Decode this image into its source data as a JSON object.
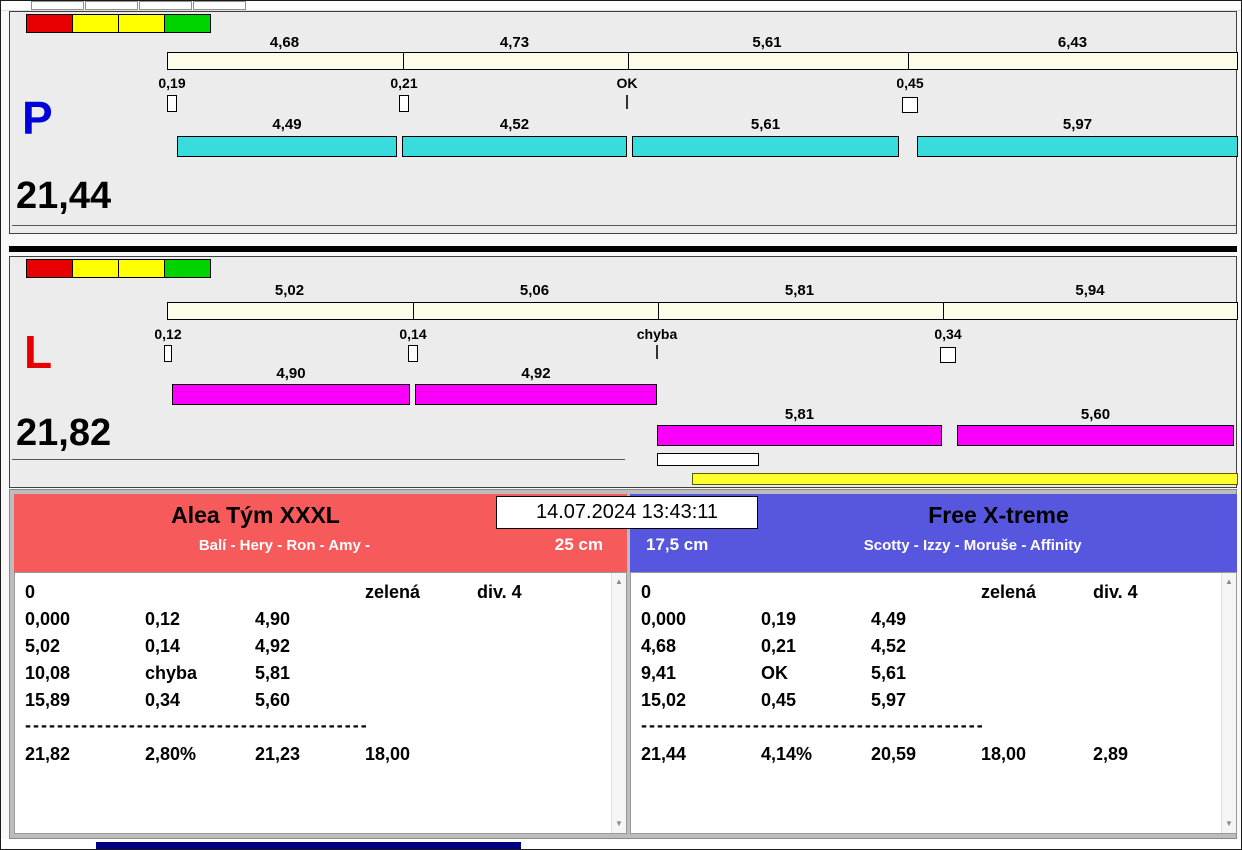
{
  "datetime": "14.07.2024 13:43:11",
  "icons": {
    "scroll_up": "▲",
    "scroll_down": "▼"
  },
  "colors": {
    "team_left_header": "#f75a5a",
    "team_right_header": "#5656de",
    "aux_bar": "#ffff2e",
    "cream_bar": "#fcfce8"
  },
  "lane_p": {
    "letter": "P",
    "letter_color": "#0000d8",
    "total": "21,44",
    "lights": [
      "#e60000",
      "#ffff00",
      "#ffff00",
      "#00d400"
    ],
    "sector_labels": [
      "4,68",
      "4,73",
      "5,61",
      "6,43"
    ],
    "tick_labels": [
      "0,19",
      "0,21",
      "OK",
      "0,45"
    ],
    "time_labels": [
      "4,49",
      "4,52",
      "5,61",
      "5,97"
    ],
    "bar_color": "#38dcdc"
  },
  "lane_l": {
    "letter": "L",
    "letter_color": "#e60000",
    "total": "21,82",
    "lights": [
      "#e60000",
      "#ffff00",
      "#ffff00",
      "#00d400"
    ],
    "sector_labels": [
      "5,02",
      "5,06",
      "5,81",
      "5,94"
    ],
    "tick_labels": [
      "0,12",
      "0,14",
      "chyba",
      "0,34"
    ],
    "time_labels": [
      "4,90",
      "4,92",
      "5,81",
      "5,60"
    ],
    "bar_color": "#fa00fa"
  },
  "team_left": {
    "name": "Alea Tým XXXL",
    "members": "Balí - Hery - Ron - Amy -",
    "height": "25 cm",
    "rows": [
      [
        "0",
        "",
        "",
        "zelená",
        "div. 4"
      ],
      [
        "0,000",
        "0,12",
        "4,90",
        "",
        ""
      ],
      [
        "5,02",
        "0,14",
        "4,92",
        "",
        ""
      ],
      [
        "10,08",
        "chyba",
        "5,81",
        "",
        ""
      ],
      [
        "15,89",
        "0,34",
        "5,60",
        "",
        ""
      ]
    ],
    "divider": "-------------------------------------------",
    "summary_rows": [
      [
        "21,82",
        "2,80%",
        "21,23",
        "18,00",
        ""
      ]
    ]
  },
  "team_right": {
    "name": "Free X-treme",
    "members": "Scotty - Izzy - Moruše - Affinity",
    "height": "17,5 cm",
    "rows": [
      [
        "0",
        "",
        "",
        "zelená",
        "div. 4"
      ],
      [
        "0,000",
        "0,19",
        "4,49",
        "",
        ""
      ],
      [
        "4,68",
        "0,21",
        "4,52",
        "",
        ""
      ],
      [
        "9,41",
        "OK",
        "5,61",
        "",
        ""
      ],
      [
        "15,02",
        "0,45",
        "5,97",
        "",
        ""
      ]
    ],
    "divider": "-------------------------------------------",
    "summary_rows": [
      [
        "21,44",
        "4,14%",
        "20,59",
        "18,00",
        "2,89"
      ]
    ]
  }
}
